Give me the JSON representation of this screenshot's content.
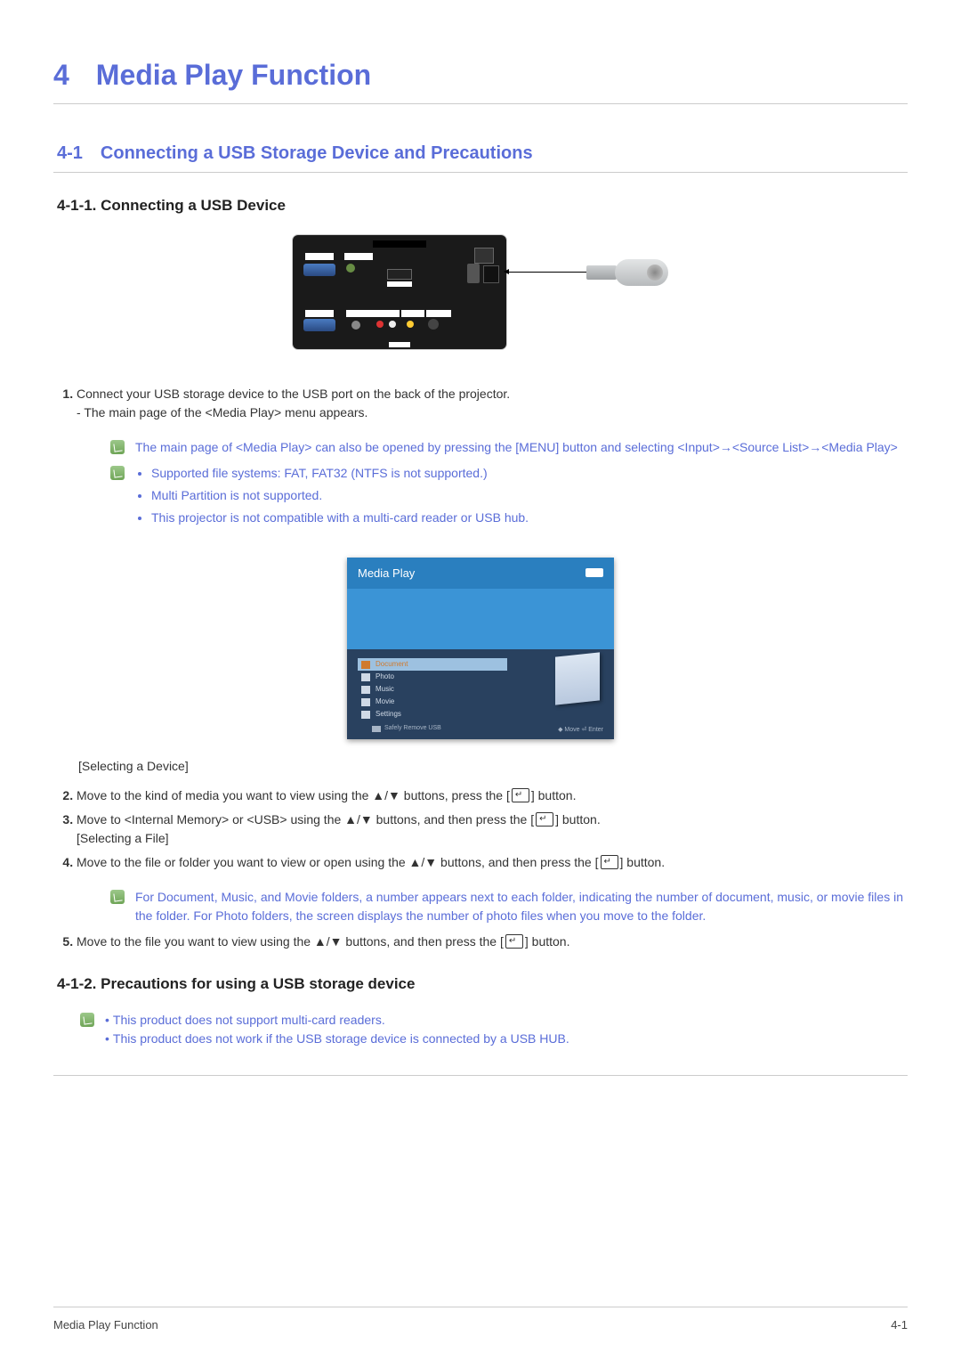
{
  "chapter": {
    "num": "4",
    "title": "Media Play Function"
  },
  "section": {
    "num": "4-1",
    "title": "Connecting a USB Storage Device and Precautions"
  },
  "sub1": {
    "title": "4-1-1. Connecting a USB Device"
  },
  "sub2": {
    "title": "4-1-2. Precautions for using a USB storage device"
  },
  "steps": {
    "s1": "Connect your USB storage device to the USB port on the back of the projector.",
    "s1a": "The main page of the <Media Play> menu appears.",
    "s2a": "Move to the kind of media you want to view using the ▲/▼ buttons, press the [",
    "s2b": "] button.",
    "s3a": "Move to <Internal Memory> or <USB> using the ▲/▼ buttons, and then press the [",
    "s3b": "] button.",
    "s4a": "Move to the file or folder you want to view or open using the ▲/▼ buttons, and then press the [",
    "s4b": "] button.",
    "s5a": "Move to the file you want to view using the ▲/▼ buttons, and then press the [",
    "s5b": "] button."
  },
  "captions": {
    "selDevice": "[Selecting a Device]",
    "selFile": "[Selecting a File]"
  },
  "notes": {
    "openMenu": "The main page of <Media Play> can also be opened by pressing the [MENU] button and selecting  <Input>→<Source List>→<Media Play>",
    "fs1": "Supported file systems: FAT, FAT32 (NTFS is not supported.)",
    "fs2": "Multi Partition is not supported.",
    "fs3": "This projector is not compatible with a multi-card reader or USB hub.",
    "folderCount": "For Document, Music, and Movie folders, a number appears next to each folder, indicating the number of document, music, or movie files in the folder. For Photo folders, the screen displays the number of photo files when you move to the folder.",
    "prec1": "This product does not support multi-card readers.",
    "prec2": "This product does not work if the USB storage device is connected by a USB HUB."
  },
  "mediaPlay": {
    "title": "Media Play",
    "items": [
      "Document",
      "Photo",
      "Music",
      "Movie",
      "Settings"
    ],
    "safely": "Safely Remove USB",
    "footerHint": "◆ Move  ⏎ Enter"
  },
  "footer": {
    "left": "Media Play Function",
    "right": "4-1"
  }
}
